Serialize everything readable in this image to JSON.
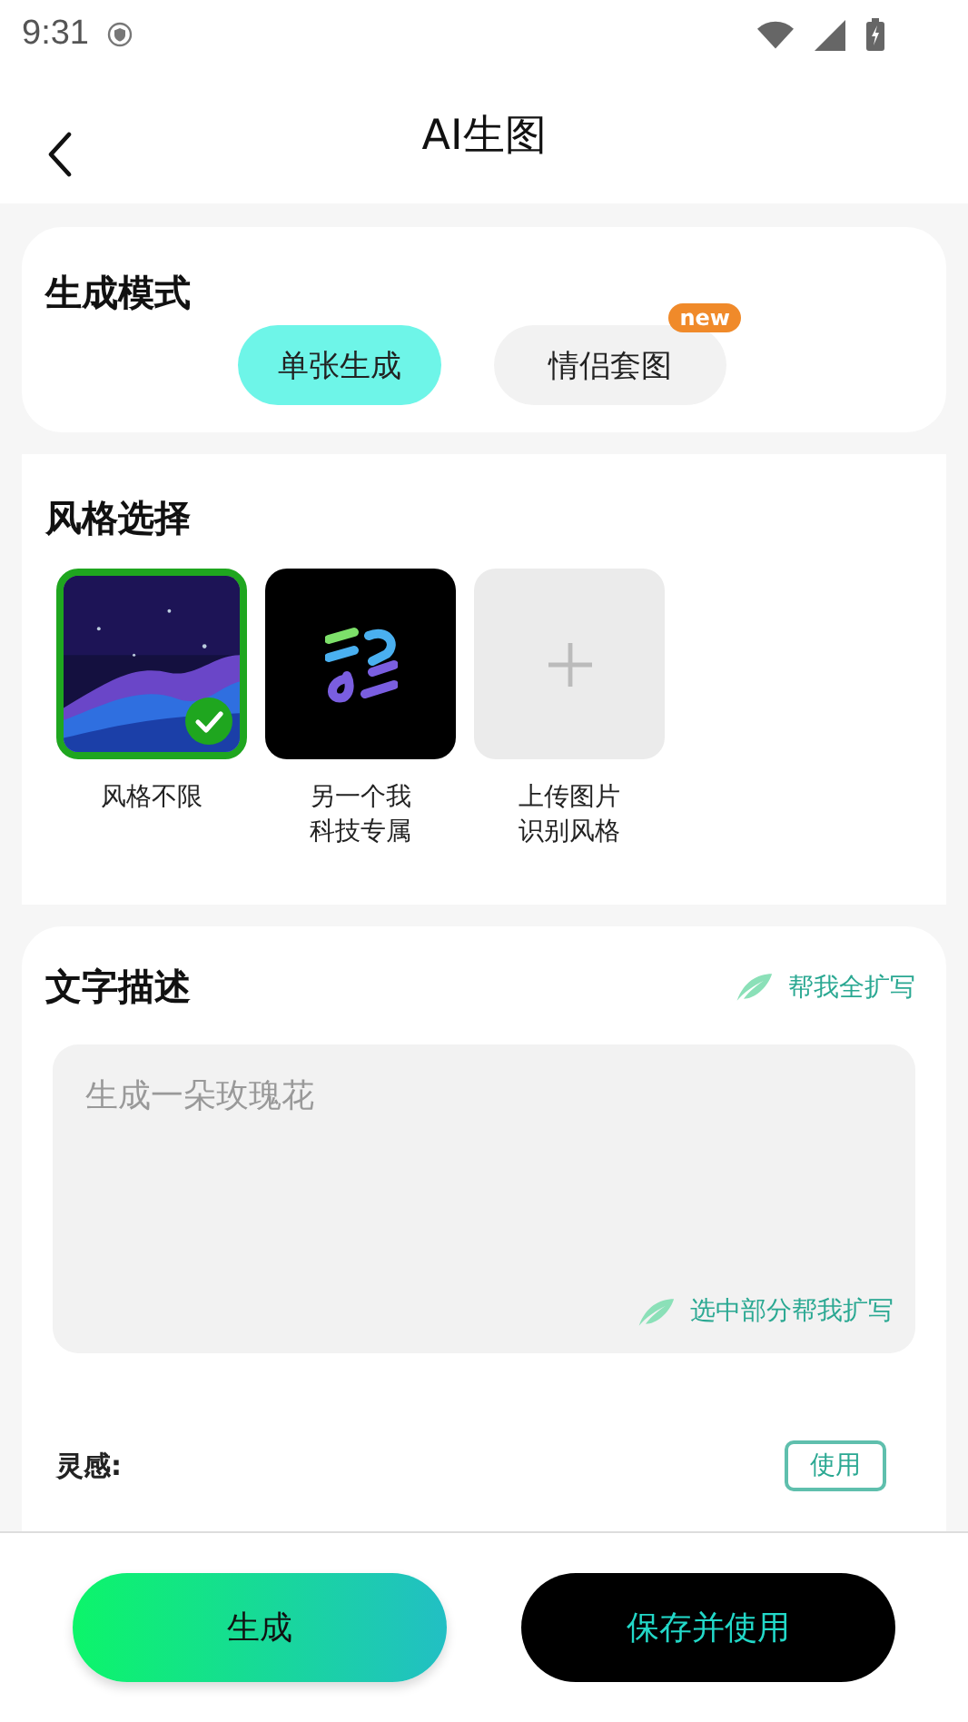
{
  "status_bar": {
    "time": "9:31"
  },
  "header": {
    "title": "AI生图"
  },
  "mode": {
    "title": "生成模式",
    "options": [
      {
        "label": "单张生成",
        "selected": true
      },
      {
        "label": "情侣套图",
        "selected": false,
        "badge": "new"
      }
    ]
  },
  "style": {
    "title": "风格选择",
    "items": [
      {
        "kind": "picture",
        "label": "风格不限",
        "selected": true
      },
      {
        "kind": "logo",
        "label": "另一个我科技专属",
        "selected": false
      },
      {
        "kind": "upload",
        "label": "上传图片识别风格",
        "selected": false
      }
    ]
  },
  "description": {
    "title": "文字描述",
    "expand_all": "帮我全扩写",
    "placeholder": "生成一朵玫瑰花",
    "expand_selected": "选中部分帮我扩写"
  },
  "inspiration": {
    "label": "灵感:",
    "use_button": "使用"
  },
  "buttons": {
    "generate": "生成",
    "save": "保存并使用"
  }
}
